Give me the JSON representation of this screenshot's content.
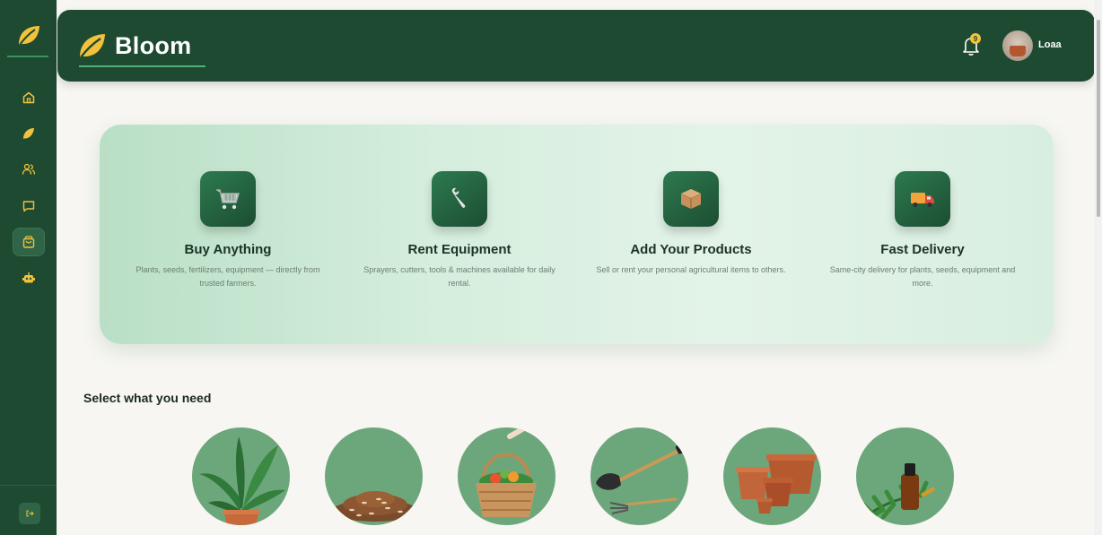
{
  "app": {
    "name": "Bloom"
  },
  "header": {
    "notification_count": "9",
    "user_name": "Loaa"
  },
  "sidebar": {
    "items": [
      {
        "icon": "home-icon"
      },
      {
        "icon": "leaf-icon"
      },
      {
        "icon": "users-icon"
      },
      {
        "icon": "chat-icon"
      },
      {
        "icon": "shopping-bag-icon",
        "active": true
      },
      {
        "icon": "robot-icon"
      }
    ],
    "logout_icon": "logout-icon"
  },
  "features": [
    {
      "icon": "cart-icon",
      "title": "Buy Anything",
      "description": "Plants, seeds, fertilizers, equipment — directly from trusted farmers."
    },
    {
      "icon": "wrench-icon",
      "title": "Rent Equipment",
      "description": "Sprayers, cutters, tools & machines available for daily rental."
    },
    {
      "icon": "box-icon",
      "title": "Add Your Products",
      "description": "Sell or rent your personal agricultural items to others."
    },
    {
      "icon": "truck-icon",
      "title": "Fast Delivery",
      "description": "Same-city delivery for plants, seeds, equipment and more."
    }
  ],
  "categories": {
    "title": "Select what you need",
    "items": [
      {
        "icon": "plant-icon"
      },
      {
        "icon": "seeds-icon"
      },
      {
        "icon": "basket-icon"
      },
      {
        "icon": "shovel-icon"
      },
      {
        "icon": "pots-icon"
      },
      {
        "icon": "oil-bottle-icon"
      }
    ]
  },
  "colors": {
    "primary": "#1f4a32",
    "accent": "#f4c13a",
    "category_bg": "#6ca77b"
  }
}
